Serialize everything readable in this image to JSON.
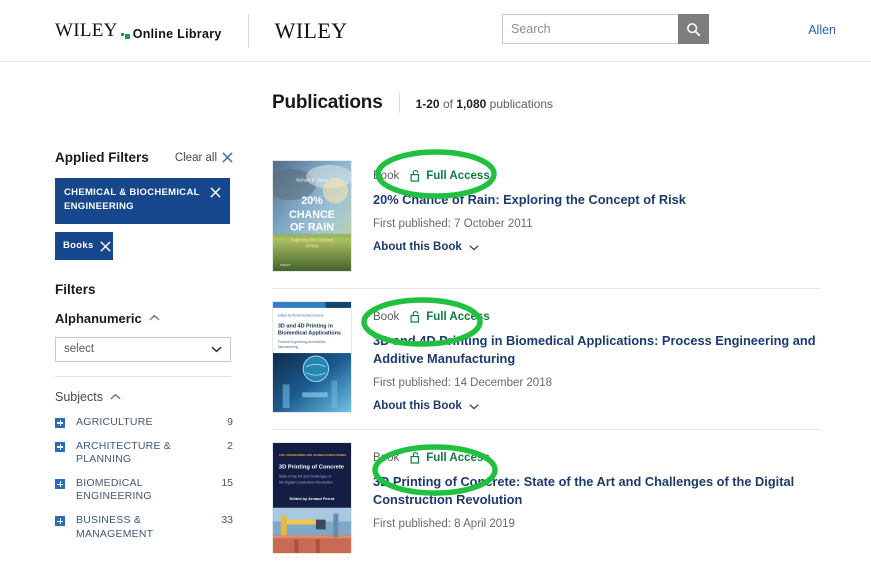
{
  "header": {
    "logo_primary": "WILEY",
    "logo_secondary": "Online Library",
    "logo_right": "WILEY",
    "search": {
      "value": "",
      "placeholder": "Search",
      "icon": "search-icon",
      "button_label": "Search"
    },
    "user": "Allen"
  },
  "page": {
    "title": "Publications",
    "range": "1-20",
    "of": "of",
    "total": "1,080",
    "unit": "publications"
  },
  "sidebar": {
    "applied_filters_title": "Applied Filters",
    "clear_all": "Clear all",
    "clear_all_icon": "close-icon",
    "chips": [
      {
        "label": "CHEMICAL & BIOCHEMICAL ENGINEERING",
        "remove_icon": "close-icon"
      },
      {
        "label": "Books",
        "remove_icon": "close-icon"
      }
    ],
    "filters_title": "Filters",
    "facets": [
      {
        "name": "Alphanumeric",
        "icon": "chevron-up-icon",
        "expanded": true
      },
      {
        "name": "Subjects",
        "icon": "chevron-up-icon",
        "expanded": true
      }
    ],
    "select": {
      "value": "select",
      "icon": "chevron-down-icon"
    },
    "subjects": [
      {
        "name": "AGRICULTURE",
        "count": "9",
        "icon": "plus-icon"
      },
      {
        "name": "ARCHITECTURE & PLANNING",
        "count": "2",
        "icon": "plus-icon"
      },
      {
        "name": "BIOMEDICAL ENGINEERING",
        "count": "15",
        "icon": "plus-icon"
      },
      {
        "name": "BUSINESS & MANAGEMENT",
        "count": "33",
        "icon": "plus-icon"
      }
    ]
  },
  "results": [
    {
      "type": "Book",
      "access": "Full Access",
      "access_icon": "unlocked-padlock-icon",
      "title": "20% Chance of Rain: Exploring the Concept of Risk",
      "published": "First published: 7 October 2011",
      "about": "About this Book",
      "about_icon": "chevron-down-icon",
      "cover_title": "20% CHANCE OF RAIN",
      "cover_author": "Richard B. Jones",
      "cover_sub": "Exploring the Concept of Risk",
      "annotated": true
    },
    {
      "type": "Book",
      "access": "Full Access",
      "access_icon": "unlocked-padlock-icon",
      "title": "3D and 4D Printing in Biomedical Applications: Process Engineering and Additive Manufacturing",
      "published": "First published: 14 December 2018",
      "about": "About this Book",
      "about_icon": "chevron-down-icon",
      "cover_title": "3D and 4D Printing in Biomedical Applications",
      "cover_sub": "Process Engineering and Additive Manufacturing",
      "annotated": true
    },
    {
      "type": "Book",
      "access": "Full Access",
      "access_icon": "unlocked-padlock-icon",
      "title": "3D Printing of Concrete: State of the Art and Challenges of the Digital Construction Revolution",
      "published": "First published: 8 April 2019",
      "about": "",
      "about_icon": "",
      "cover_title": "3D Printing of Concrete",
      "cover_sub": "State of the Art and Challenges of the Digital Construction Revolution",
      "cover_author": "Edited by Arnaud Perrot",
      "annotated": true
    }
  ],
  "annotations": {
    "color": "#22c040",
    "shape": "ellipse",
    "count": 3,
    "target": "Full Access badge"
  },
  "colors": {
    "brand_navy": "#16478c",
    "link_navy": "#1c3a6e",
    "access_green": "#0e7a3f",
    "annotation_green": "#22c040",
    "logo_green": "#1a9e4b",
    "user_link_blue": "#1b63b0"
  }
}
